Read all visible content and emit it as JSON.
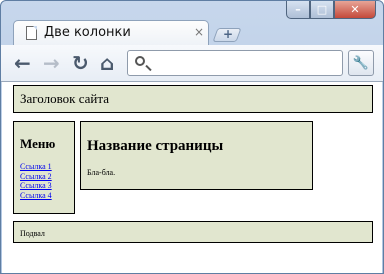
{
  "browser": {
    "tab_title": "Две колонки",
    "tab_close": "×",
    "new_tab": "+",
    "controls": {
      "minimize": "–",
      "maximize": "□",
      "close": "✕"
    },
    "nav": {
      "back": "←",
      "forward": "→",
      "reload": "↻",
      "home": "⌂"
    },
    "omnibox": {
      "value": "",
      "placeholder": ""
    },
    "wrench": "🔧",
    "icons": [
      "page-icon",
      "search-icon",
      "wrench-icon"
    ]
  },
  "page": {
    "header": "Заголовок сайта",
    "sidebar": {
      "title": "Меню",
      "links": [
        "Ссылка 1",
        "Ссылка 2",
        "Ссылка 3",
        "Ссылка 4"
      ]
    },
    "content": {
      "title": "Название страницы",
      "text": "Бла-бла."
    },
    "footer": "Подвал"
  },
  "colors": {
    "box_background": "#e1e6cf",
    "chrome": "#c7d7ec"
  }
}
